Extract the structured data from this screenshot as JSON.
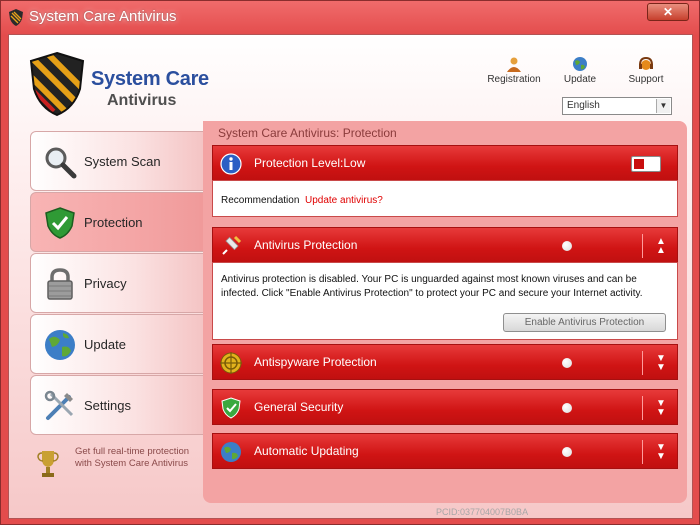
{
  "window": {
    "title": "System Care Antivirus",
    "close_label": "✕"
  },
  "logo": {
    "line1": "System Care",
    "line2": "Antivirus"
  },
  "toplinks": [
    {
      "label": "Registration",
      "icon": "user-icon"
    },
    {
      "label": "Update",
      "icon": "globe-icon"
    },
    {
      "label": "Support",
      "icon": "support-icon"
    }
  ],
  "language": {
    "selected": "English"
  },
  "sidebar": {
    "items": [
      {
        "label": "System Scan",
        "icon": "magnifier-icon",
        "active": false
      },
      {
        "label": "Protection",
        "icon": "shield-check-icon",
        "active": true
      },
      {
        "label": "Privacy",
        "icon": "padlock-icon",
        "active": false
      },
      {
        "label": "Update",
        "icon": "globe-icon",
        "active": false
      },
      {
        "label": "Settings",
        "icon": "tools-icon",
        "active": false
      }
    ],
    "promo": "Get full real-time protection with System Care Antivirus"
  },
  "panel": {
    "title": "System Care Antivirus: Protection",
    "protection_level": "Protection Level:Low",
    "recommendation_label": "Recommendation",
    "recommendation_link": "Update antivirus?",
    "sections": [
      {
        "label": "Antivirus Protection",
        "expanded": true,
        "description": "Antivirus protection is disabled. Your PC is unguarded against most known viruses and can be infected. Click \"Enable Antivirus Protection\" to protect your PC and secure your Internet activity.",
        "button": "Enable Antivirus Protection"
      },
      {
        "label": "Antispyware Protection",
        "expanded": false
      },
      {
        "label": "General Security",
        "expanded": false
      },
      {
        "label": "Automatic Updating",
        "expanded": false
      }
    ]
  },
  "footer": {
    "pcid": "PCID:037704007B0BA"
  },
  "colors": {
    "accent_red": "#d01414",
    "panel_pink": "#f3a3a3",
    "logo_blue": "#2b4f9e",
    "link_red": "#e00000"
  }
}
